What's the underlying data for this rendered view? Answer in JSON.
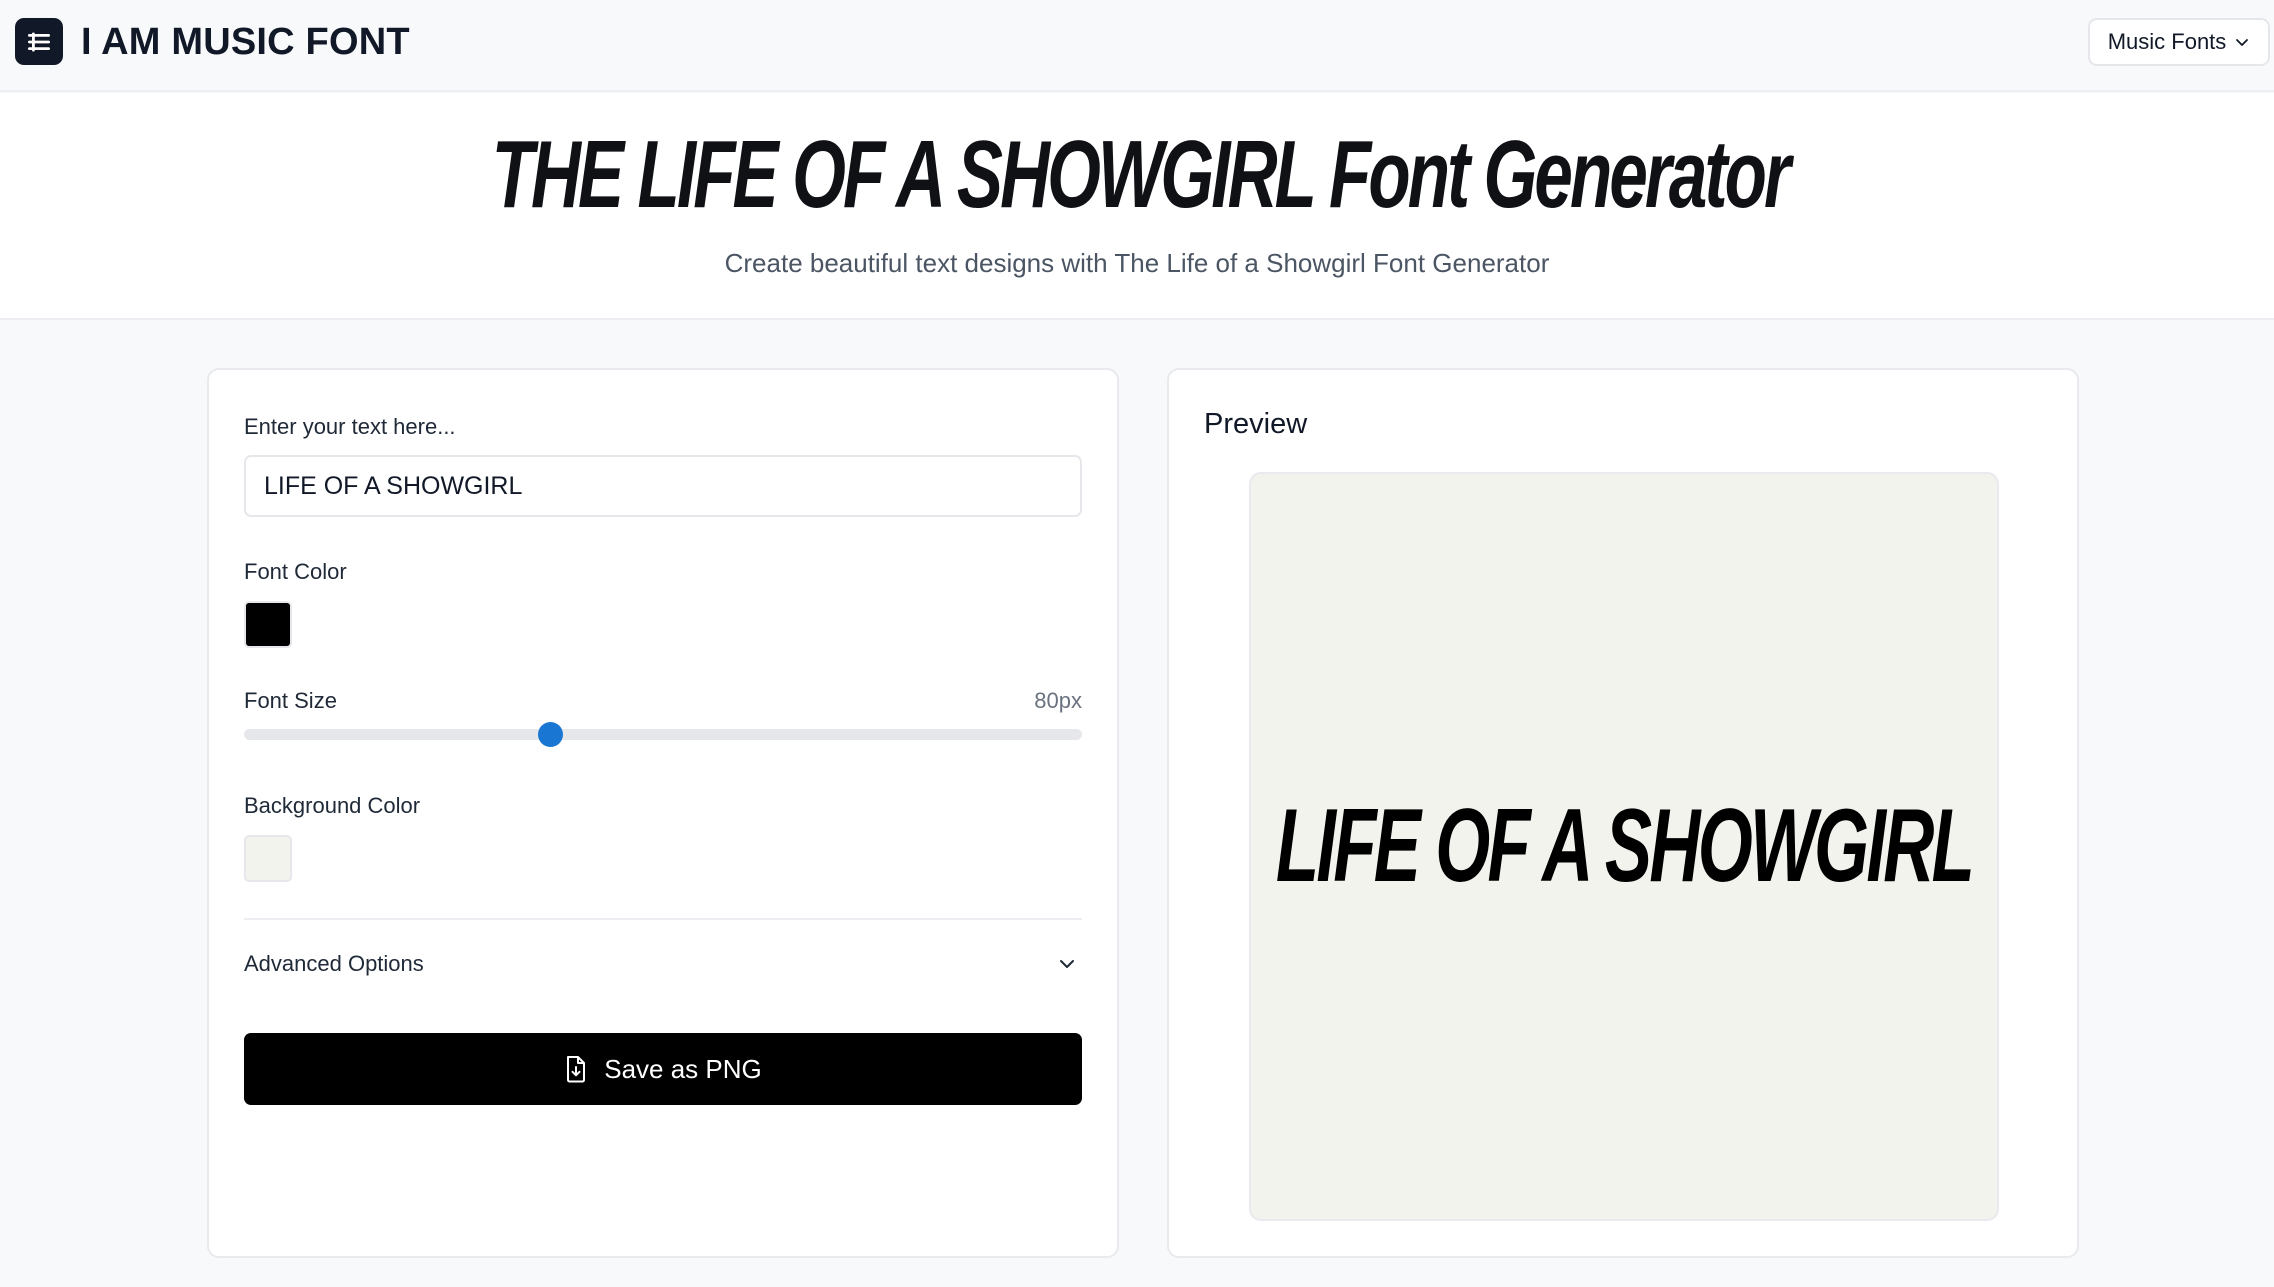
{
  "header": {
    "brand": "I AM MUSIC FONT",
    "logo_icon": "menu-list-icon",
    "nav_dropdown_label": "Music Fonts",
    "nav_dropdown_icon": "chevron-down-icon"
  },
  "hero": {
    "title": "THE LIFE OF A SHOWGIRL Font Generator",
    "subtitle": "Create beautiful text designs with The Life of a Showgirl Font Generator"
  },
  "controls": {
    "text_label": "Enter your text here...",
    "text_value": "LIFE OF A SHOWGIRL",
    "font_color_label": "Font Color",
    "font_color": "#000000",
    "font_size_label": "Font Size",
    "font_size_value": "80px",
    "font_size_fraction": 0.365,
    "background_color_label": "Background Color",
    "background_color": "#f3f3ee",
    "advanced_label": "Advanced Options",
    "advanced_icon": "chevron-down-icon",
    "save_label": "Save as PNG",
    "save_icon": "file-download-icon"
  },
  "preview": {
    "title": "Preview",
    "text": "LIFE OF A SHOWGIRL"
  },
  "colors": {
    "slider_accent": "#1976d2",
    "button_bg": "#000000"
  }
}
